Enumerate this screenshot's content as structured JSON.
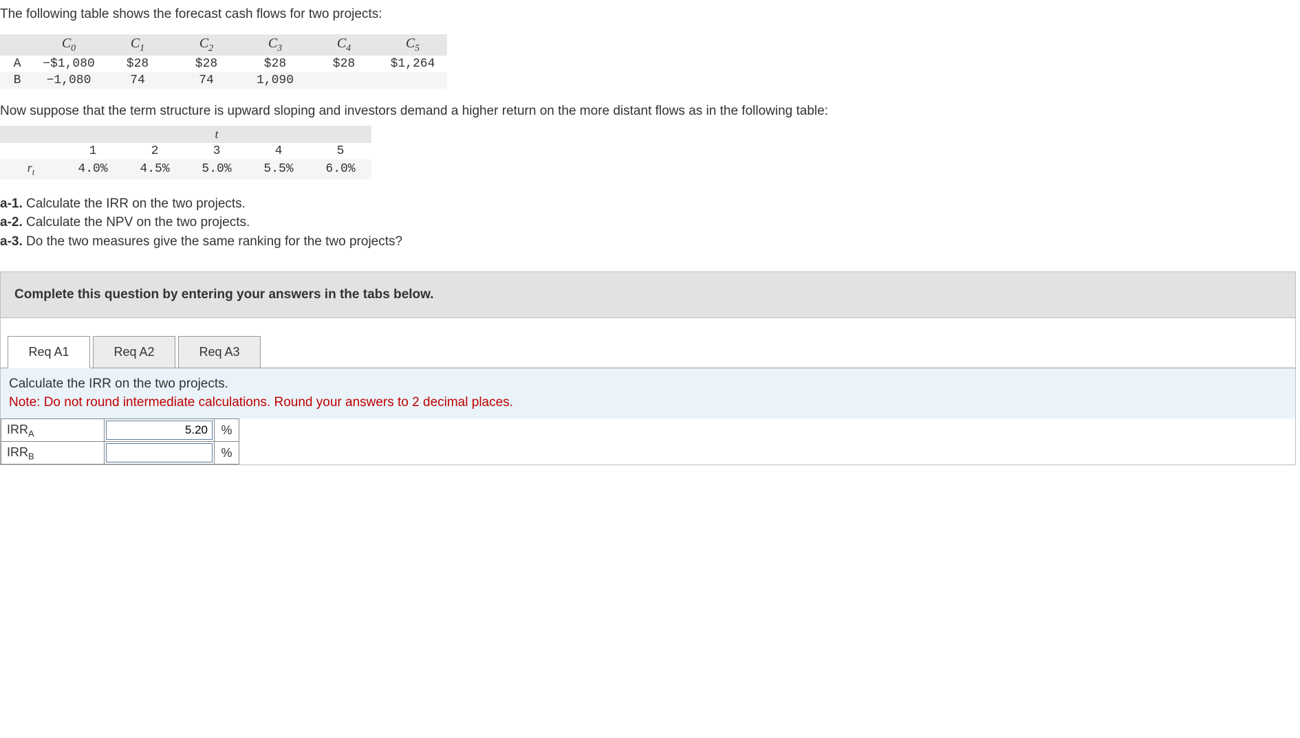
{
  "intro": "The following table shows the forecast cash flows for two projects:",
  "cf": {
    "headers": {
      "c0": "C",
      "c1": "C",
      "c2": "C",
      "c3": "C",
      "c4": "C",
      "c5": "C",
      "s0": "0",
      "s1": "1",
      "s2": "2",
      "s3": "3",
      "s4": "4",
      "s5": "5"
    },
    "rowA": {
      "label": "A",
      "c0": "−$1,080",
      "c1": "$28",
      "c2": "$28",
      "c3": "$28",
      "c4": "$28",
      "c5": "$1,264"
    },
    "rowB": {
      "label": "B",
      "c0": "−1,080",
      "c1": "74",
      "c2": "74",
      "c3": "1,090",
      "c4": "",
      "c5": ""
    }
  },
  "para2": "Now suppose that the term structure is upward sloping and investors demand a higher return on the more distant flows as in the following table:",
  "ts": {
    "topheader": "t",
    "cols": {
      "t1": "1",
      "t2": "2",
      "t3": "3",
      "t4": "4",
      "t5": "5"
    },
    "rowlabel": "r",
    "rowlabel_sub": "t",
    "vals": {
      "r1": "4.0%",
      "r2": "4.5%",
      "r3": "5.0%",
      "r4": "5.5%",
      "r5": "6.0%"
    }
  },
  "questions": {
    "a1_b": "a-1.",
    "a1_t": " Calculate the IRR on the two projects.",
    "a2_b": "a-2.",
    "a2_t": " Calculate the NPV on the two projects.",
    "a3_b": "a-3.",
    "a3_t": " Do the two measures give the same ranking for the two projects?"
  },
  "answer": {
    "header": "Complete this question by entering your answers in the tabs below.",
    "tabs": {
      "t1": "Req A1",
      "t2": "Req A2",
      "t3": "Req A3"
    },
    "instr_line1": "Calculate the IRR on the two projects.",
    "instr_note": "Note: Do not round intermediate calculations. Round your answers to 2 decimal places.",
    "irr": {
      "rowA_label": "IRR",
      "rowA_sub": "A",
      "rowA_val": "5.20",
      "unit": "%",
      "rowB_label": "IRR",
      "rowB_sub": "B",
      "rowB_val": ""
    }
  }
}
